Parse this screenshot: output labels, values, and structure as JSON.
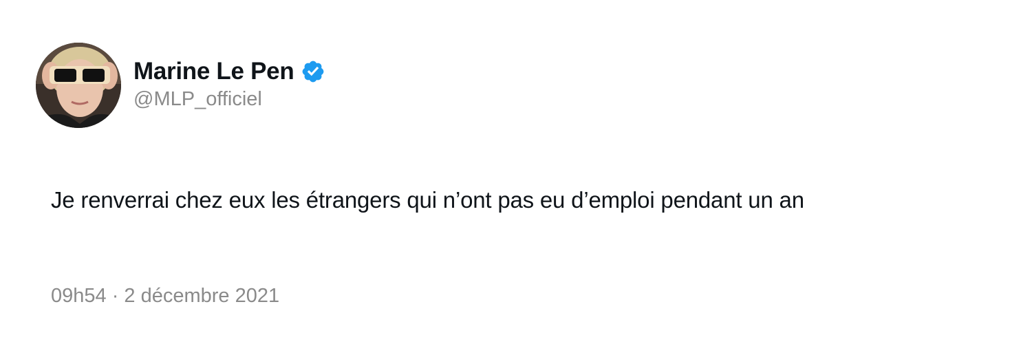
{
  "tweet": {
    "author": {
      "display_name": "Marine Le Pen",
      "handle": "@MLP_officiel",
      "verified": true,
      "verified_badge_color": "#1d9bf0",
      "avatar": "profile-photo"
    },
    "text": "Je renverrai chez eux les étrangers qui n’ont pas eu d’emploi pendant un an",
    "timestamp": "09h54 · 2 décembre 2021"
  },
  "colors": {
    "text_primary": "#0f1419",
    "text_secondary": "#8a8a8a",
    "background": "#ffffff"
  }
}
